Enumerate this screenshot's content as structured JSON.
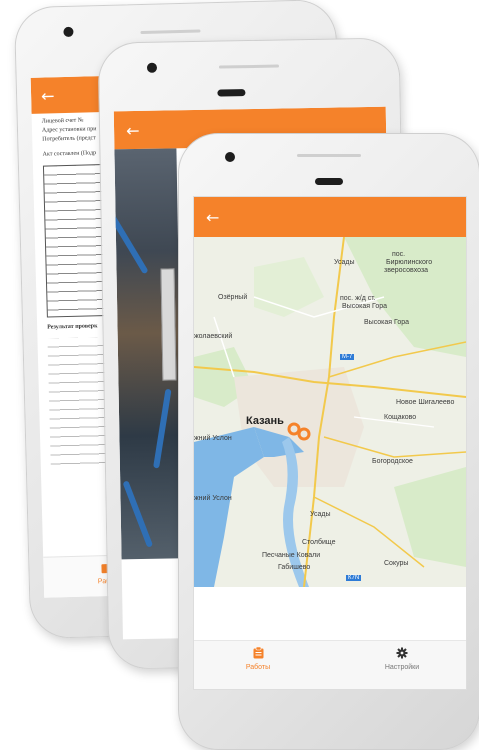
{
  "colors": {
    "accent": "#f5822a",
    "map_bg": "#eef0e6",
    "water": "#7fb7e6",
    "road": "#f2c94c"
  },
  "back_icon": "←",
  "phone1": {
    "doc_lines": [
      "Лицевой счет №",
      "Адрес установки при",
      "Потребитель (предст",
      "Акт составлен (Подр"
    ],
    "result_line": "Результат проверк",
    "tab_fragment": "Рабо"
  },
  "map": {
    "labels": {
      "usady_n": "Усады",
      "pos_birul": "пос.",
      "birul": "Бирюлинского",
      "zverosovhoz": "зверосовхоза",
      "ozerny": "Озёрный",
      "pos_zhd": "пос. ж/д ст.",
      "vysokaya_gora_st": "Высокая Гора",
      "vysokaya_gora": "Высокая Гора",
      "pokolaevsky": "жолаевский",
      "m7": "M-7",
      "kazan": "Казань",
      "novoe_shigaleevo": "Новое Шигалеево",
      "koschakovo": "Кощаково",
      "usloon_1": "жний Услон",
      "bogorodskoe": "Богородское",
      "usloon_2": "жний Услон",
      "usady_s": "Усады",
      "stolbishche": "Столбище",
      "peschanye_kovali": "Песчаные Ковали",
      "sokury": "Сокуры",
      "gabishevo": "Габишево",
      "r7n": "К7N"
    }
  },
  "nav": {
    "works_label": "Работы",
    "works_icon": "clipboard-icon",
    "settings_label": "Настройки",
    "settings_icon": "gear-icon"
  }
}
